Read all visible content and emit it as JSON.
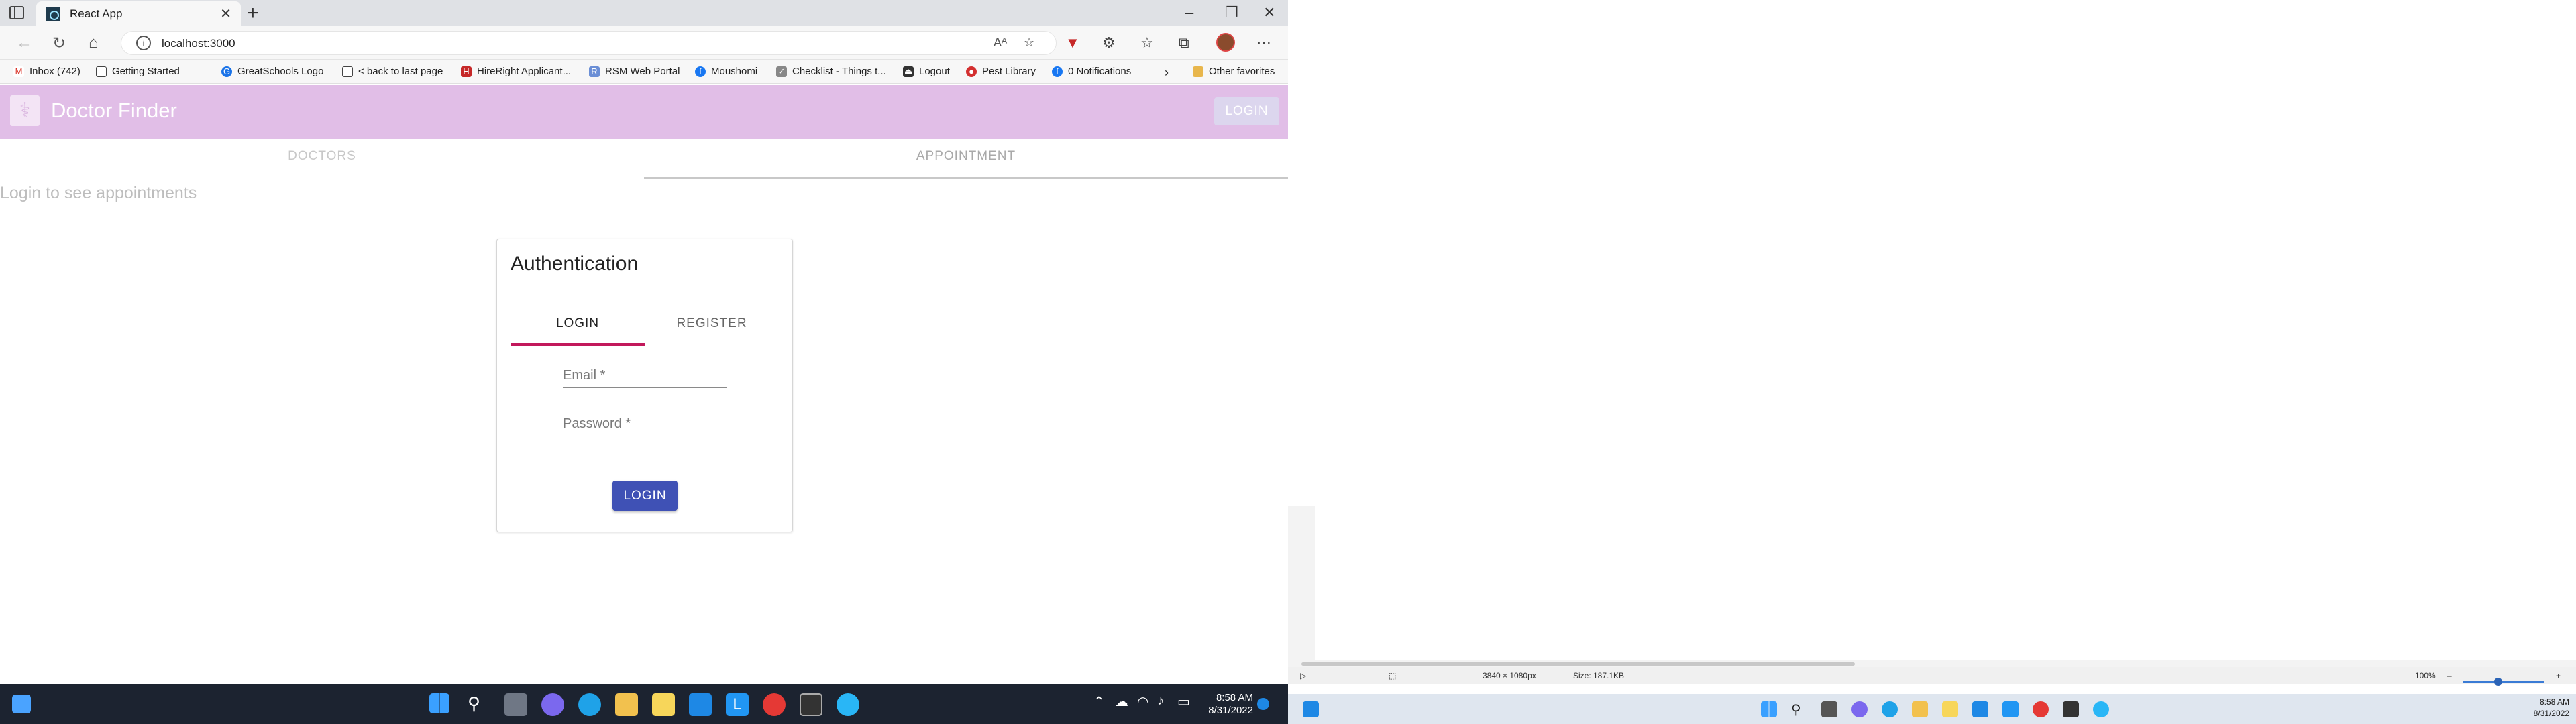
{
  "browser": {
    "tab_title": "React App",
    "url": "localhost:3000",
    "favorites": [
      {
        "label": "Inbox (742)",
        "icon": "gmail-icon"
      },
      {
        "label": "Getting Started",
        "icon": "page-icon"
      },
      {
        "label": "GreatSchools Logo",
        "icon": "greatschools-icon"
      },
      {
        "label": "< back to last page",
        "icon": "page-icon"
      },
      {
        "label": "HireRight Applicant...",
        "icon": "hireright-icon"
      },
      {
        "label": "RSM Web Portal",
        "icon": "rsm-icon"
      },
      {
        "label": "Moushomi",
        "icon": "facebook-icon"
      },
      {
        "label": "Checklist - Things t...",
        "icon": "checklist-icon"
      },
      {
        "label": "Logout",
        "icon": "logout-icon"
      },
      {
        "label": "Pest Library",
        "icon": "pest-icon"
      },
      {
        "label": "0 Notifications",
        "icon": "facebook-icon"
      }
    ],
    "other_favorites": "Other favorites"
  },
  "app": {
    "title": "Doctor Finder",
    "login_button": "LOGIN",
    "tabs": [
      "DOCTORS",
      "APPOINTMENT"
    ],
    "login_message": "Login to see appointments",
    "auth": {
      "title": "Authentication",
      "tabs": [
        "LOGIN",
        "REGISTER"
      ],
      "email_label": "Email *",
      "password_label": "Password *",
      "submit": "LOGIN"
    }
  },
  "taskbar": {
    "time": "8:58 AM",
    "date": "8/31/2022"
  },
  "viewer": {
    "dimensions": "3840 × 1080px",
    "size": "Size: 187.1KB",
    "zoom": "100%",
    "time": "8:58 AM",
    "date": "8/31/2022"
  },
  "colors": {
    "appbar": "#e1bee7",
    "tab_indicator": "#c2185b",
    "primary_button": "#3f51b5"
  }
}
